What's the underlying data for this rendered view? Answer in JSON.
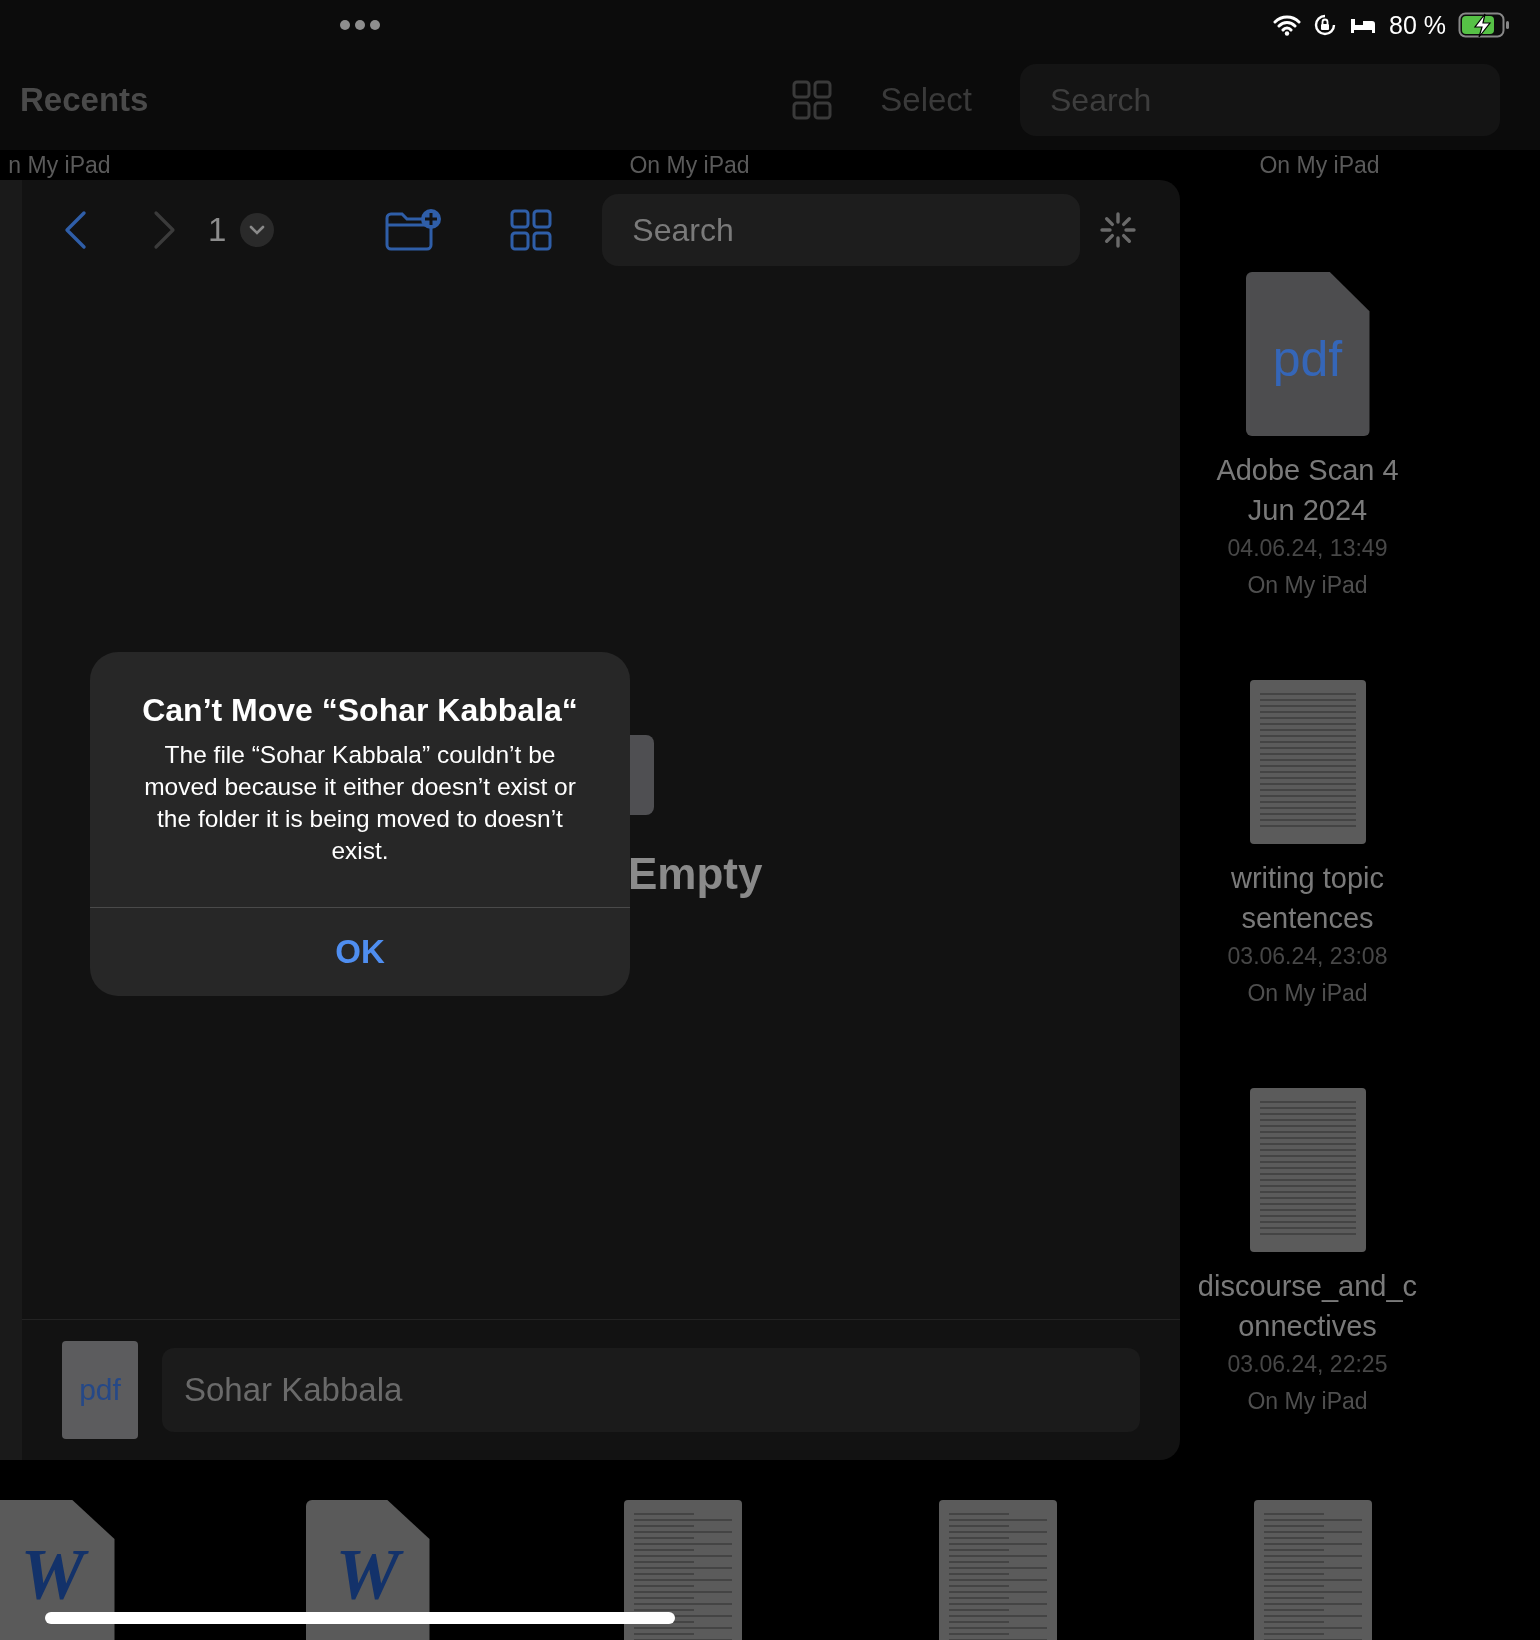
{
  "status_bar": {
    "battery_text": "80 %",
    "charging": true
  },
  "nav_bar": {
    "title": "Recents",
    "select": "Select",
    "search": {
      "placeholder": "Search"
    }
  },
  "top_locations": [
    {
      "text": "n My iPad"
    },
    {
      "text": "On My iPad"
    },
    {
      "text": "On My iPad"
    }
  ],
  "recents": [
    {
      "kind": "pdf",
      "icon_label": "pdf",
      "name_lines": [
        "Adobe Scan 4",
        "Jun 2024"
      ],
      "date": "04.06.24, 13:49",
      "location": "On My iPad"
    },
    {
      "kind": "document",
      "name_lines": [
        "writing topic",
        "sentences"
      ],
      "date": "03.06.24, 23:08",
      "location": "On My iPad"
    },
    {
      "kind": "document",
      "name_lines": [
        "discourse_and_c",
        "onnectives"
      ],
      "date": "03.06.24, 22:25",
      "location": "On My iPad"
    }
  ],
  "bottom_files": [
    {
      "kind": "word",
      "glyph": "W"
    },
    {
      "kind": "word",
      "glyph": "W"
    },
    {
      "kind": "document"
    },
    {
      "kind": "document"
    },
    {
      "kind": "document"
    }
  ],
  "sheet": {
    "page": "1",
    "search": {
      "placeholder": "Search"
    },
    "empty_label": "Empty",
    "file_icon_label": "pdf",
    "file_name": "Sohar Kabbala"
  },
  "alert": {
    "title": "Can’t Move “Sohar Kabbala“",
    "message": "The file “Sohar Kabbala” couldn’t be moved because it either doesn’t exist or the folder it is being moved to doesn’t exist.",
    "button": "OK"
  }
}
